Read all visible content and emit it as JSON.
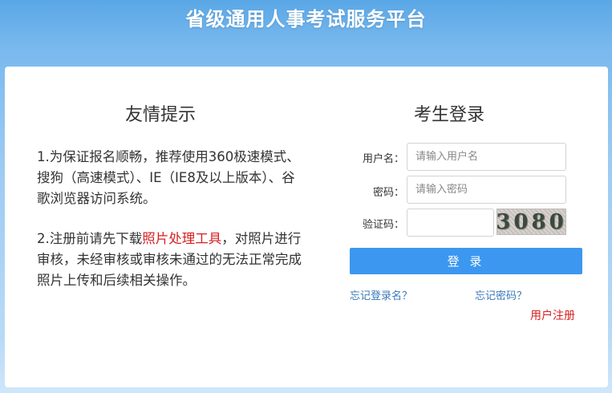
{
  "site": {
    "title": "省级通用人事考试服务平台"
  },
  "tips": {
    "title": "友情提示",
    "para1": "1.为保证报名顺畅，推荐使用360极速模式、搜狗（高速模式）、IE（IE8及以上版本）、谷歌浏览器访问系统。",
    "para2_before": "2.注册前请先下载",
    "para2_link": "照片处理工具",
    "para2_after": "，对照片进行审核，未经审核或审核未通过的无法正常完成照片上传和后续相关操作。"
  },
  "login": {
    "title": "考生登录",
    "username_label": "用户名：",
    "username_placeholder": "请输入用户名",
    "password_label": "密码：",
    "password_placeholder": "请输入密码",
    "captcha_label": "验证码：",
    "captcha_value": "",
    "captcha_text": "3080",
    "submit_label": "登 录",
    "forgot_username": "忘记登录名？",
    "forgot_password": "忘记密码？",
    "register": "用户注册"
  },
  "colors": {
    "accent_button": "#3b97f0",
    "link_blue": "#3a78b8",
    "link_red": "#d61f1f"
  }
}
